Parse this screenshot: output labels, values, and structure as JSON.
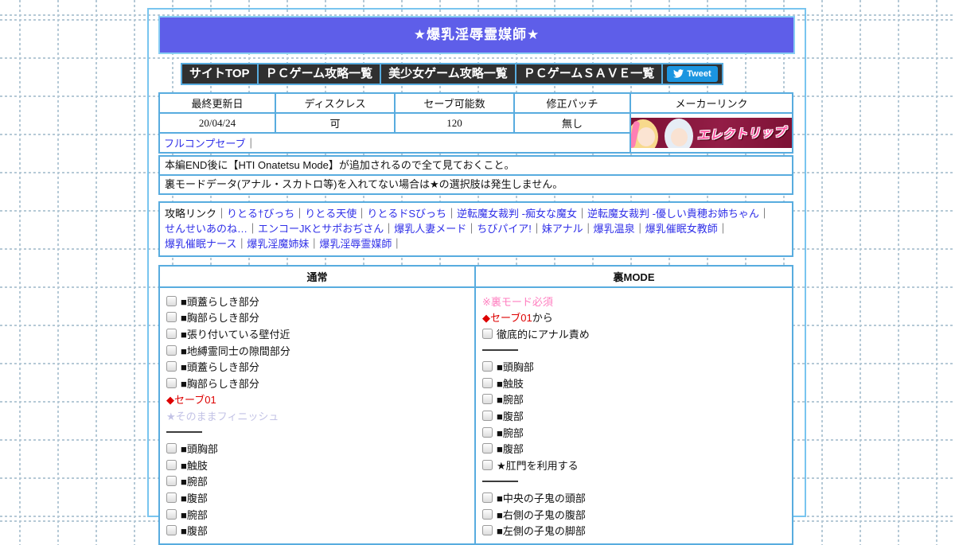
{
  "page": {
    "title": "★爆乳淫辱霊媒師★"
  },
  "nav": {
    "items": [
      {
        "label": "サイトTOP"
      },
      {
        "label": "ＰＣゲーム攻略一覧"
      },
      {
        "label": "美少女ゲーム攻略一覧"
      },
      {
        "label": "ＰＣゲームＳＡＶＥ一覧"
      }
    ],
    "tweet_label": "Tweet"
  },
  "info_table": {
    "headers": [
      "最終更新日",
      "ディスクレス",
      "セーブ可能数",
      "修正パッチ",
      "メーカーリンク"
    ],
    "values": [
      {
        "text": "20/04/24",
        "serif": true
      },
      {
        "text": "可",
        "serif": false
      },
      {
        "text": "120",
        "serif": true
      },
      {
        "text": "無し",
        "serif": false
      }
    ],
    "full_comp_label": "フルコンプセーブ",
    "separator": "｜",
    "banner_text": "エレクトリップ"
  },
  "notes": [
    "本編END後に【HTI Onatetsu Mode】が追加されるので全て見ておくこと。",
    "裏モードデータ(アナル・スカトロ等)を入れてない場合は★の選択肢は発生しません。"
  ],
  "walkthrough_links": {
    "label": "攻略リンク",
    "separator": "｜",
    "lines": [
      [
        "りとる†びっち",
        "りとる天使",
        "りとるドSびっち",
        "逆転魔女裁判 -痴女な魔女",
        "逆転魔女裁判 -優しい貴穂お姉ちゃん"
      ],
      [
        "せんせいあのね…",
        "エンコーJKとサポおぢさん",
        "爆乳人妻メード",
        "ちびパイア!",
        "妹アナル",
        "爆乳温泉",
        "爆乳催眠女教師"
      ],
      [
        "爆乳催眠ナース",
        "爆乳淫魔姉妹",
        "爆乳淫辱霊媒師"
      ]
    ]
  },
  "columns": {
    "normal": {
      "header": "通常",
      "items": [
        {
          "kind": "checkbox",
          "parts": [
            {
              "text": "■頭蓋らしき部分",
              "style": "plain"
            }
          ]
        },
        {
          "kind": "checkbox",
          "parts": [
            {
              "text": "■胸部らしき部分",
              "style": "plain"
            }
          ]
        },
        {
          "kind": "checkbox",
          "parts": [
            {
              "text": "■張り付いている壁付近",
              "style": "plain"
            }
          ]
        },
        {
          "kind": "checkbox",
          "parts": [
            {
              "text": "■地縛霊同士の隙間部分",
              "style": "plain"
            }
          ]
        },
        {
          "kind": "checkbox",
          "parts": [
            {
              "text": "■頭蓋らしき部分",
              "style": "plain"
            }
          ]
        },
        {
          "kind": "checkbox",
          "parts": [
            {
              "text": "■胸部らしき部分",
              "style": "plain"
            }
          ]
        },
        {
          "kind": "text",
          "parts": [
            {
              "text": "◆セーブ01",
              "style": "red"
            }
          ]
        },
        {
          "kind": "text",
          "parts": [
            {
              "text": "★そのままフィニッシュ",
              "style": "lavender"
            }
          ]
        },
        {
          "kind": "divider",
          "parts": []
        },
        {
          "kind": "checkbox",
          "parts": [
            {
              "text": "■頭胸部",
              "style": "plain"
            }
          ]
        },
        {
          "kind": "checkbox",
          "parts": [
            {
              "text": "■触肢",
              "style": "plain"
            }
          ]
        },
        {
          "kind": "checkbox",
          "parts": [
            {
              "text": "■腕部",
              "style": "plain"
            }
          ]
        },
        {
          "kind": "checkbox",
          "parts": [
            {
              "text": "■腹部",
              "style": "plain"
            }
          ]
        },
        {
          "kind": "checkbox",
          "parts": [
            {
              "text": "■腕部",
              "style": "plain"
            }
          ]
        },
        {
          "kind": "checkbox",
          "parts": [
            {
              "text": "■腹部",
              "style": "plain"
            }
          ]
        }
      ]
    },
    "ura": {
      "header": "裏MODE",
      "items": [
        {
          "kind": "text",
          "parts": [
            {
              "text": "※裏モード必須",
              "style": "pink"
            }
          ]
        },
        {
          "kind": "text",
          "parts": [
            {
              "text": "◆セーブ01",
              "style": "red"
            },
            {
              "text": "から",
              "style": "plain"
            }
          ]
        },
        {
          "kind": "checkbox",
          "parts": [
            {
              "text": "徹底的にアナル責め",
              "style": "plain"
            }
          ]
        },
        {
          "kind": "divider",
          "parts": []
        },
        {
          "kind": "checkbox",
          "parts": [
            {
              "text": "■頭胸部",
              "style": "plain"
            }
          ]
        },
        {
          "kind": "checkbox",
          "parts": [
            {
              "text": "■触肢",
              "style": "plain"
            }
          ]
        },
        {
          "kind": "checkbox",
          "parts": [
            {
              "text": "■腕部",
              "style": "plain"
            }
          ]
        },
        {
          "kind": "checkbox",
          "parts": [
            {
              "text": "■腹部",
              "style": "plain"
            }
          ]
        },
        {
          "kind": "checkbox",
          "parts": [
            {
              "text": "■腕部",
              "style": "plain"
            }
          ]
        },
        {
          "kind": "checkbox",
          "parts": [
            {
              "text": "■腹部",
              "style": "plain"
            }
          ]
        },
        {
          "kind": "checkbox",
          "parts": [
            {
              "text": "★肛門を利用する",
              "style": "plain"
            }
          ]
        },
        {
          "kind": "divider",
          "parts": []
        },
        {
          "kind": "checkbox",
          "parts": [
            {
              "text": "■中央の子鬼の頭部",
              "style": "plain"
            }
          ]
        },
        {
          "kind": "checkbox",
          "parts": [
            {
              "text": "■右側の子鬼の腹部",
              "style": "plain"
            }
          ]
        },
        {
          "kind": "checkbox",
          "parts": [
            {
              "text": "■左側の子鬼の脚部",
              "style": "plain"
            }
          ]
        }
      ]
    }
  },
  "colors": {
    "grid_line": "#b5c9d6",
    "outer_border": "#79c5ef",
    "title_bg": "#5e5ee9",
    "table_border": "#58acdf",
    "nav_bg": "#303030",
    "tweet_blue": "#1b95e0",
    "link_blue": "#3030e8",
    "red": "#dd0000",
    "pink": "#ff7fc0",
    "lavender": "#c3c3e6",
    "banner_bg": "#7c1134",
    "banner_text_pink": "#ff4f9f"
  }
}
